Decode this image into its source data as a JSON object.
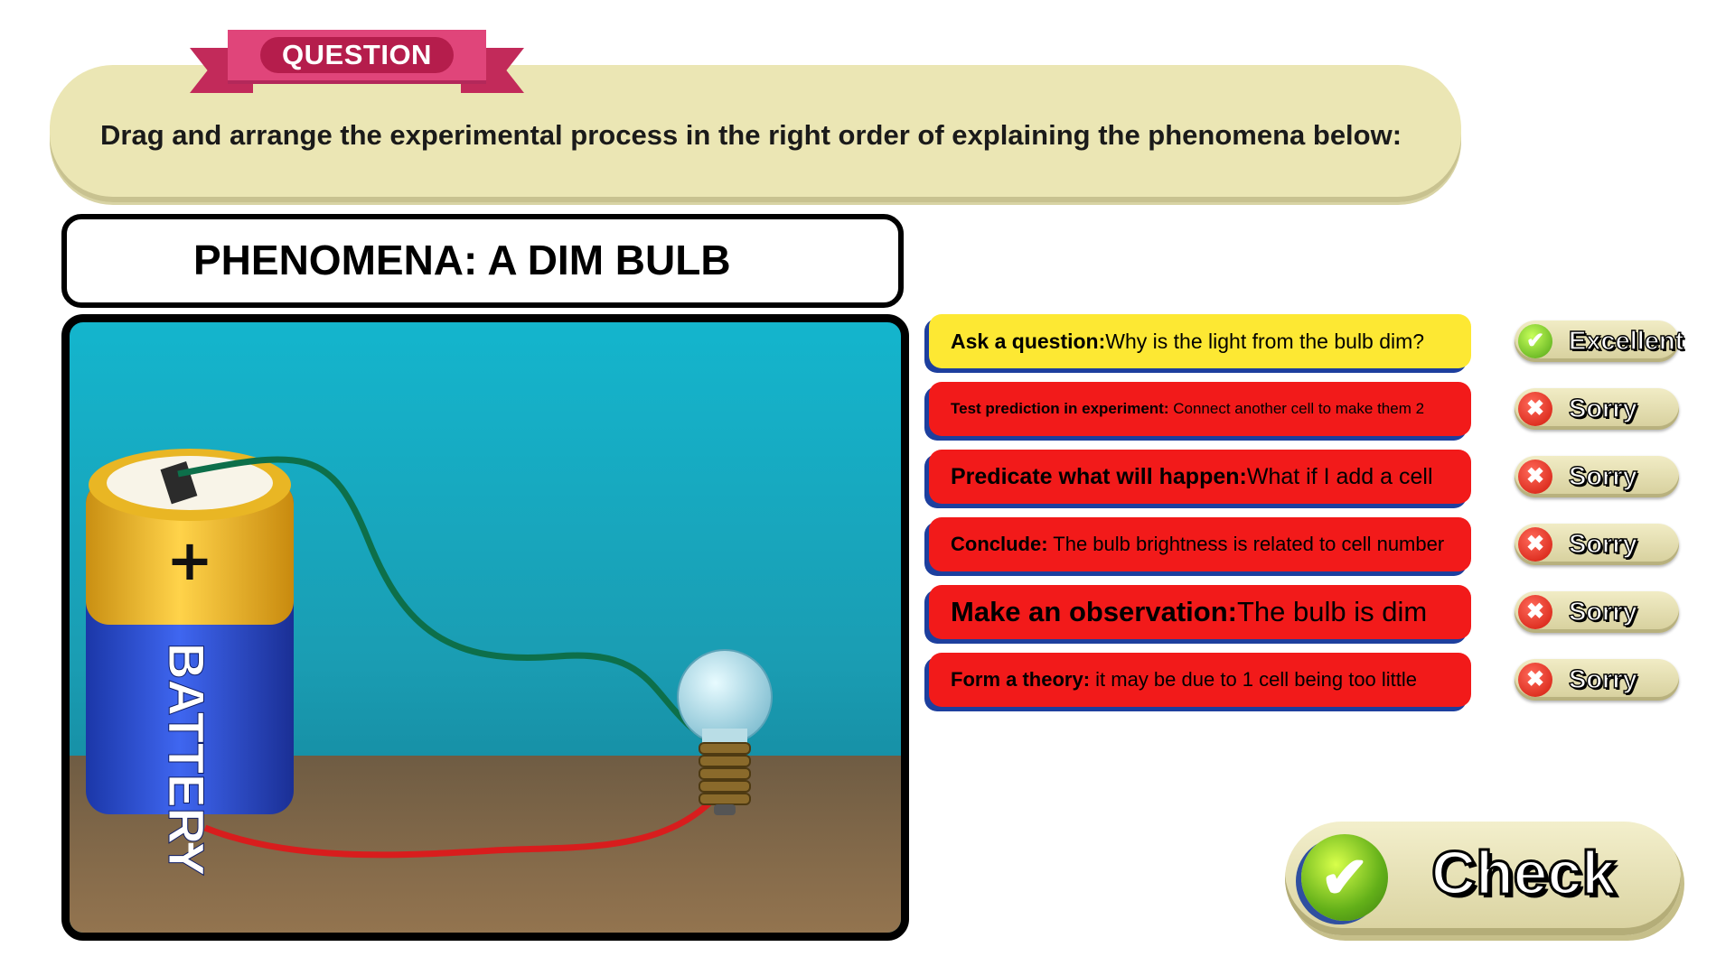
{
  "question": {
    "badge": "QUESTION",
    "text": "Drag and arrange the experimental process in the right order of explaining the phenomena below:"
  },
  "phenomena": {
    "title": "PHENOMENA: A DIM BULB"
  },
  "illustration": {
    "battery_label": "BATTERY",
    "plus_sign": "+",
    "minus_sign": "-"
  },
  "steps": [
    {
      "title": "Ask a question:",
      "text": "Why is the light from the bulb dim?",
      "color": "#fde833"
    },
    {
      "title": "Test prediction in experiment:",
      "text": " Connect another cell to make them 2",
      "color": "#f21a1a"
    },
    {
      "title": "Predicate what will happen:",
      "text": "What if I add a cell",
      "color": "#f21a1a"
    },
    {
      "title": "Conclude:",
      "text": " The bulb brightness is related to cell number",
      "color": "#f21a1a"
    },
    {
      "title": "Make an observation:",
      "text": "The bulb is dim",
      "color": "#f21a1a"
    },
    {
      "title": "Form a theory:",
      "text": " it may be due to 1 cell being too little",
      "color": "#f21a1a"
    }
  ],
  "results": [
    {
      "label": "Excellent",
      "icon": "check-icon",
      "correct": true
    },
    {
      "label": "Sorry",
      "icon": "cross-icon",
      "correct": false
    },
    {
      "label": "Sorry",
      "icon": "cross-icon",
      "correct": false
    },
    {
      "label": "Sorry",
      "icon": "cross-icon",
      "correct": false
    },
    {
      "label": "Sorry",
      "icon": "cross-icon",
      "correct": false
    },
    {
      "label": "Sorry",
      "icon": "cross-icon",
      "correct": false
    }
  ],
  "check_button": {
    "label": "Check",
    "icon": "check-icon"
  },
  "colors": {
    "banner_bg": "#ebe6b4",
    "ribbon": "#e0457a",
    "step_red": "#f21a1a",
    "step_yellow": "#fde833",
    "step_shadow": "#1d3f9e"
  }
}
